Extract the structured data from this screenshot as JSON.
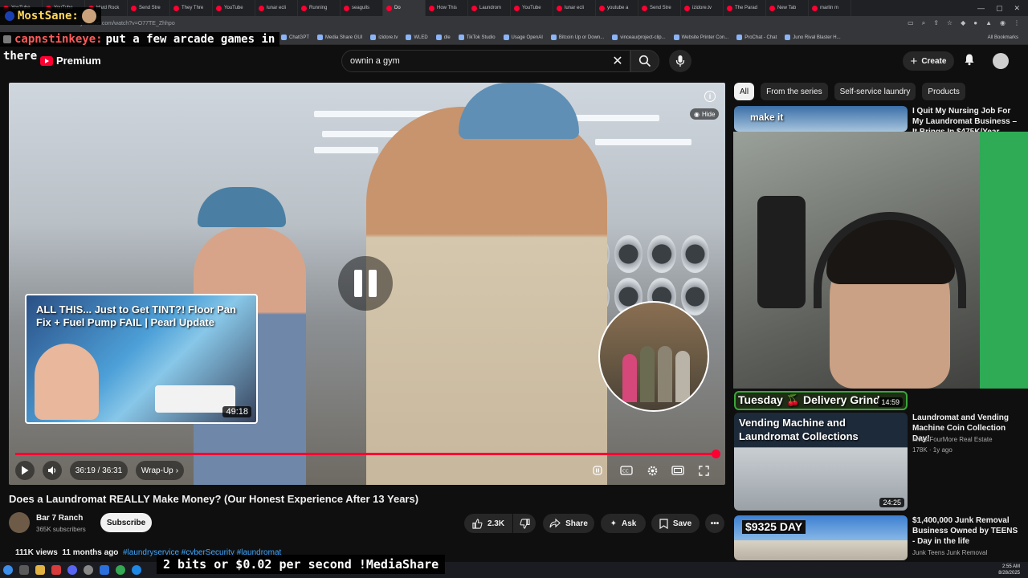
{
  "browser": {
    "tabs": [
      "YouTube",
      "YouTube",
      "Hard Rock",
      "Send Stre",
      "They Thre",
      "YouTube",
      "lunar ecli",
      "Running",
      "seagulls",
      "Do",
      "How This",
      "Laundrom",
      "YouTube",
      "lunar ecli",
      "youtube a",
      "Send Stre",
      "izidore.tv",
      "The Parad",
      "New Tab",
      "marlin m"
    ],
    "url": "youtube.com/watch?v=O77TE_Zhhpo",
    "bookmarks": [
      "ChatGPT",
      "Media Share GUI",
      "izidore.tv",
      "WLED",
      "dle",
      "TikTok Studio",
      "Usage OpenAI",
      "Bitcoin Up or Down...",
      "vinceau/project-clip...",
      "Website Printer Con...",
      "ProChat - Chat",
      "Juno Rival Blaster H..."
    ],
    "all_bookmarks": "All Bookmarks"
  },
  "overlay": {
    "chat1_name": "MostSane:",
    "chat2_name": "capnstinkeye:",
    "chat2_msg": "put a few arcade games in",
    "chat3_msg": "there",
    "chat4_msg": "2 bits or $0.02 per second !MediaShare"
  },
  "header": {
    "logo_text": "Premium",
    "search_value": "ownin a gym",
    "create_label": "Create"
  },
  "player": {
    "hide_label": "Hide",
    "time": "36:19 / 36:31",
    "chapter": "Wrap-Up",
    "progress": 0.995,
    "endcard_title": "ALL THIS... Just to Get TINT?! Floor Pan Fix + Fuel Pump FAIL | Pearl Update",
    "endcard_duration": "49:18"
  },
  "video": {
    "title": "Does a Laundromat REALLY Make Money? (Our Honest Experience After 13 Years)",
    "channel": "Bar 7 Ranch",
    "subscribers": "365K subscribers",
    "subscribe_label": "Subscribe",
    "likes": "2.3K",
    "share_label": "Share",
    "ask_label": "Ask",
    "save_label": "Save",
    "views": "111K views",
    "age": "11 months ago",
    "tags": "#laundryservice #cyberSecurity #laundromat"
  },
  "sidebar": {
    "chips": [
      "All",
      "From the series",
      "Self-service laundry",
      "Products"
    ],
    "recs": [
      {
        "title": "I Quit My Nursing Job For My Laundromat Business – It Brings In $475K/Year",
        "thumb_text": "make it",
        "duration": "",
        "channel": "",
        "meta": ""
      },
      {
        "title": "",
        "thumb_text": "Tuesday 🍒 Delivery Grind",
        "duration": "14:59",
        "channel": "",
        "meta": ""
      },
      {
        "title": "Laundromat and Vending Machine Coin Collection Day!",
        "thumb_text": "Vending Machine and Laundromat Collections",
        "duration": "24:25",
        "channel": "InvestFourMore Real Estate",
        "meta": "178K · 1y ago"
      },
      {
        "title": "$1,400,000 Junk Removal Business Owned by TEENS - Day in the life",
        "thumb_text": "$9325 DAY",
        "duration": "",
        "channel": "Junk Teens Junk Removal",
        "meta": ""
      }
    ]
  },
  "system": {
    "time": "2:55 AM",
    "date": "8/28/2025"
  },
  "colors": {
    "accent": "#ff0033",
    "background": "#0f0f0f"
  }
}
